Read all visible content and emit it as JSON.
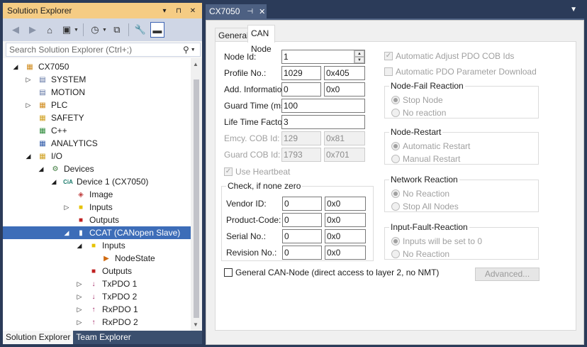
{
  "solution_explorer": {
    "title": "Solution Explorer",
    "title_buttons": [
      "▾",
      "⊓",
      "✕"
    ],
    "search_placeholder": "Search Solution Explorer (Ctrl+;)",
    "tree": [
      {
        "label": "CX7050",
        "level": 0,
        "expander": "◢",
        "icon": "plc-project-icon"
      },
      {
        "label": "SYSTEM",
        "level": 1,
        "expander": "▷",
        "icon": "system-icon"
      },
      {
        "label": "MOTION",
        "level": 1,
        "expander": "",
        "icon": "motion-icon"
      },
      {
        "label": "PLC",
        "level": 1,
        "expander": "▷",
        "icon": "plc-icon"
      },
      {
        "label": "SAFETY",
        "level": 1,
        "expander": "",
        "icon": "safety-icon"
      },
      {
        "label": "C++",
        "level": 1,
        "expander": "",
        "icon": "cpp-icon"
      },
      {
        "label": "ANALYTICS",
        "level": 1,
        "expander": "",
        "icon": "analytics-icon"
      },
      {
        "label": "I/O",
        "level": 1,
        "expander": "◢",
        "icon": "io-icon"
      },
      {
        "label": "Devices",
        "level": 2,
        "expander": "◢",
        "icon": "devices-icon"
      },
      {
        "label": "Device 1 (CX7050)",
        "level": 3,
        "expander": "◢",
        "icon": "cia-device-icon"
      },
      {
        "label": "Image",
        "level": 4,
        "expander": "",
        "icon": "image-icon"
      },
      {
        "label": "Inputs",
        "level": 4,
        "expander": "▷",
        "icon": "inputs-folder-icon"
      },
      {
        "label": "Outputs",
        "level": 4,
        "expander": "",
        "icon": "outputs-icon"
      },
      {
        "label": "CCAT (CANopen Slave)",
        "level": 4,
        "expander": "◢",
        "icon": "ccat-icon",
        "selected": true
      },
      {
        "label": "Inputs",
        "level": 5,
        "expander": "◢",
        "icon": "inputs-folder-icon"
      },
      {
        "label": "NodeState",
        "level": 6,
        "expander": "",
        "icon": "nodestate-icon"
      },
      {
        "label": "Outputs",
        "level": 5,
        "expander": "",
        "icon": "outputs-icon"
      },
      {
        "label": "TxPDO 1",
        "level": 5,
        "expander": "▷",
        "icon": "txpdo-icon"
      },
      {
        "label": "TxPDO 2",
        "level": 5,
        "expander": "▷",
        "icon": "txpdo-icon"
      },
      {
        "label": "RxPDO 1",
        "level": 5,
        "expander": "▷",
        "icon": "rxpdo-icon"
      },
      {
        "label": "RxPDO 2",
        "level": 5,
        "expander": "▷",
        "icon": "rxpdo-icon"
      }
    ],
    "bottom_tabs": [
      "Solution Explorer",
      "Team Explorer"
    ]
  },
  "document": {
    "tab_title": "CX7050",
    "tabs": [
      "General",
      "CAN Node"
    ],
    "active_tab": "CAN Node"
  },
  "can_node": {
    "node_id_label": "Node Id:",
    "node_id": "1",
    "profile_label": "Profile No.:",
    "profile_dec": "1029",
    "profile_hex": "0x405",
    "add_info_label": "Add. Information:",
    "add_info_dec": "0",
    "add_info_hex": "0x0",
    "guard_time_label": "Guard Time (ms):",
    "guard_time": "100",
    "life_time_label": "Life Time Factor:",
    "life_time": "3",
    "emcy_label": "Emcy. COB Id:",
    "emcy_dec": "129",
    "emcy_hex": "0x81",
    "guard_cob_label": "Guard COB Id:",
    "guard_cob_dec": "1793",
    "guard_cob_hex": "0x701",
    "use_heartbeat": "Use Heartbeat",
    "check_group": {
      "caption": "Check, if none zero",
      "vendor_label": "Vendor ID:",
      "vendor_dec": "0",
      "vendor_hex": "0x0",
      "product_label": "Product-Code:",
      "product_dec": "0",
      "product_hex": "0x0",
      "serial_label": "Serial No.:",
      "serial_dec": "0",
      "serial_hex": "0x0",
      "revision_label": "Revision No.:",
      "revision_dec": "0",
      "revision_hex": "0x0"
    },
    "auto_adjust_pdo": "Automatic Adjust PDO COB Ids",
    "auto_pdo_param": "Automatic PDO Parameter Download",
    "node_fail": {
      "caption": "Node-Fail Reaction",
      "opt1": "Stop Node",
      "opt2": "No reaction"
    },
    "node_restart": {
      "caption": "Node-Restart",
      "opt1": "Automatic Restart",
      "opt2": "Manual Restart"
    },
    "network_reaction": {
      "caption": "Network Reaction",
      "opt1": "No Reaction",
      "opt2": "Stop All Nodes"
    },
    "input_fault": {
      "caption": "Input-Fault-Reaction",
      "opt1": "Inputs will be set to 0",
      "opt2": "No Reaction"
    },
    "general_can_node": "General CAN-Node (direct access to layer 2, no NMT)",
    "advanced_button": "Advanced..."
  }
}
